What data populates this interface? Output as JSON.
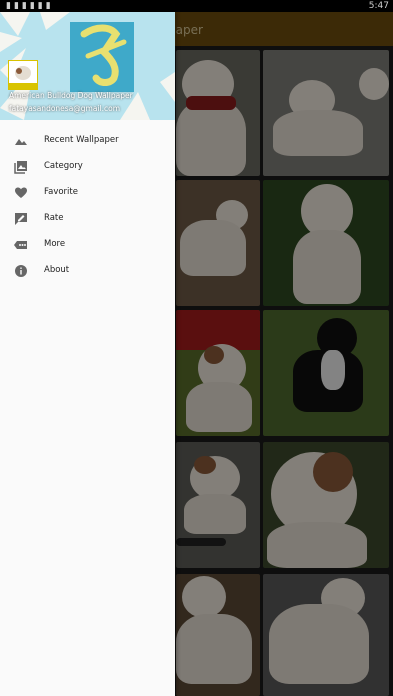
{
  "status_bar": {
    "time": "5:47",
    "icons": [
      "notification-icon",
      "notification-icon",
      "notification-icon",
      "notification-icon",
      "notification-icon",
      "notification-icon"
    ]
  },
  "app_bar": {
    "title": "paper"
  },
  "drawer": {
    "app_name": "American Bulldog Dog Wallpaper",
    "email": "fatayasandonesa@gmail.com",
    "items": [
      {
        "label": "Recent Wallpaper",
        "icon": "landscape-icon"
      },
      {
        "label": "Category",
        "icon": "photo-library-icon"
      },
      {
        "label": "Favorite",
        "icon": "heart-icon"
      },
      {
        "label": "Rate",
        "icon": "rate-review-icon"
      },
      {
        "label": "More",
        "icon": "more-horiz-icon"
      },
      {
        "label": "About",
        "icon": "info-icon"
      }
    ]
  },
  "colors": {
    "app_bar": "#6e4e0d",
    "drawer_bg": "#fafafa",
    "header_bg": "#a9dbe8",
    "text": "#222222",
    "icon": "#666666"
  }
}
